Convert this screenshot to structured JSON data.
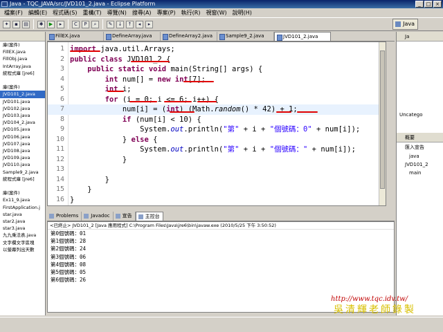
{
  "window": {
    "title": "Java - TQC_JAVA/src/JVD101_2.java - Eclipse Platform"
  },
  "menu": [
    "檔案(F)",
    "編輯(E)",
    "程式碼(S)",
    "重構(T)",
    "導覽(N)",
    "搜尋(A)",
    "專案(P)",
    "執行(R)",
    "視窗(W)",
    "說明(H)"
  ],
  "perspective": {
    "label": "Java"
  },
  "editor_tabs": [
    "FillEX.java",
    "DefineArray.java",
    "DefineArray2.java",
    "Sample9_2.java",
    "JVD101_2.java"
  ],
  "active_editor_tab": 4,
  "left_panel": {
    "items": [
      "庫(案件)",
      "FillEX.java",
      "FillObj.java",
      "IntArray.java",
      "統程式庫 [jre6]",
      "",
      "庫(案件)",
      "JVD101_2.java",
      "JVD101.java",
      "JVD102.java",
      "JVD103.java",
      "JVD104_2.java",
      "JVD105.java",
      "JVD106.java",
      "JVD107.java",
      "JVD108.java",
      "JVD109.java",
      "JVD110.java",
      "Sample9_2.java",
      "統程式庫 [jre6]",
      "",
      "庫(案件)",
      "Ex11_9.java",
      "FirstApplication.j",
      "star.java",
      "star2.java",
      "star3.java",
      "九九乘法表.java",
      "文字欄文字區塊",
      "以螢幕列出天數"
    ]
  },
  "code_lines": [
    {
      "n": "1",
      "html": "<span class='kw'>import</span> java.util.Arrays;"
    },
    {
      "n": "2",
      "html": "<span class='kw'>public</span> <span class='kw'>class</span> JVD101_2 {"
    },
    {
      "n": "3",
      "html": "    <span class='kw'>public</span> <span class='kw'>static</span> <span class='kw'>void</span> main(String[] args) {"
    },
    {
      "n": "4",
      "html": "        <span class='kw'>int</span> num[] = <span class='kw'>new</span> <span class='kw'>int</span>[7];"
    },
    {
      "n": "5",
      "html": "        <span class='kw'>int</span> i;"
    },
    {
      "n": "6",
      "html": "        <span class='kw'>for</span> (i = 0; i &lt;= 6; i++) {"
    },
    {
      "n": "7",
      "html": "            num[i] = (<span class='kw'>int</span>) (Math.<span class='it'>random</span>() * 42) + 1;"
    },
    {
      "n": "8",
      "html": "            <span class='kw'>if</span> (num[i] &lt; 10) {"
    },
    {
      "n": "9",
      "html": "                System.<span class='fld it'>out</span>.println(<span class='str'>\"第\"</span> + i + <span class='str'>\"個號碼：0\"</span> + num[i]);"
    },
    {
      "n": "10",
      "html": "            } <span class='kw'>else</span> {"
    },
    {
      "n": "11",
      "html": "                System.<span class='fld it'>out</span>.println(<span class='str'>\"第\"</span> + i + <span class='str'>\"個號碼：\"</span> + num[i]);"
    },
    {
      "n": "12",
      "html": "            }"
    },
    {
      "n": "13",
      "html": ""
    },
    {
      "n": "14",
      "html": "        }"
    },
    {
      "n": "15",
      "html": "    }"
    },
    {
      "n": "16",
      "html": "}"
    }
  ],
  "current_line": 7,
  "console_tabs": [
    "Problems",
    "Javadoc",
    "宣告",
    "主控台"
  ],
  "active_console_tab": 3,
  "console": {
    "header": "<已終止> JVD101_2 [Java 應用程式] C:\\Program Files\\Java\\jre6\\bin\\javaw.exe (2010/5/25 下午 3:50:52)",
    "lines": [
      "第0個號碼：01",
      "第1個號碼：28",
      "第2個號碼：24",
      "第3個號碼：06",
      "第4個號碼：08",
      "第5個號碼：05",
      "第6個號碼：26"
    ]
  },
  "right_panel": {
    "head1": "Ja",
    "head2": "概要",
    "items": [
      "Uncatego",
      "匯入宣告",
      "java",
      "JVD101_2",
      "main"
    ]
  },
  "watermark": {
    "url": "http://www.tqc.idv.tw/",
    "signature": "吳清輝老師錄製"
  },
  "icons": [
    "save-icon",
    "print-icon",
    "debug-icon",
    "run-icon",
    "new-class-icon",
    "search-icon",
    "back-icon",
    "forward-icon"
  ]
}
